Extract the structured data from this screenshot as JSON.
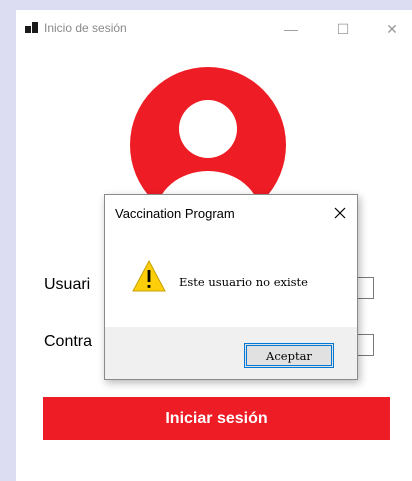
{
  "window": {
    "title": "Inicio de sesión",
    "icons": {
      "app": "app-icon",
      "minimize": "minimize-icon",
      "maximize": "maximize-icon",
      "close": "close-icon"
    },
    "controls": {
      "minimize": "—",
      "maximize": "☐",
      "close": "✕"
    }
  },
  "login": {
    "avatar_icon": "user-avatar-icon",
    "user_label": "Usuari",
    "password_label": "Contra",
    "submit_label": "Iniciar sesión",
    "accent_color": "#ee1c24"
  },
  "dialog": {
    "title": "Vaccination Program",
    "message": "Este usuario no existe",
    "ok_label": "Aceptar",
    "icon": "warning-icon",
    "close_icon": "close-icon"
  }
}
